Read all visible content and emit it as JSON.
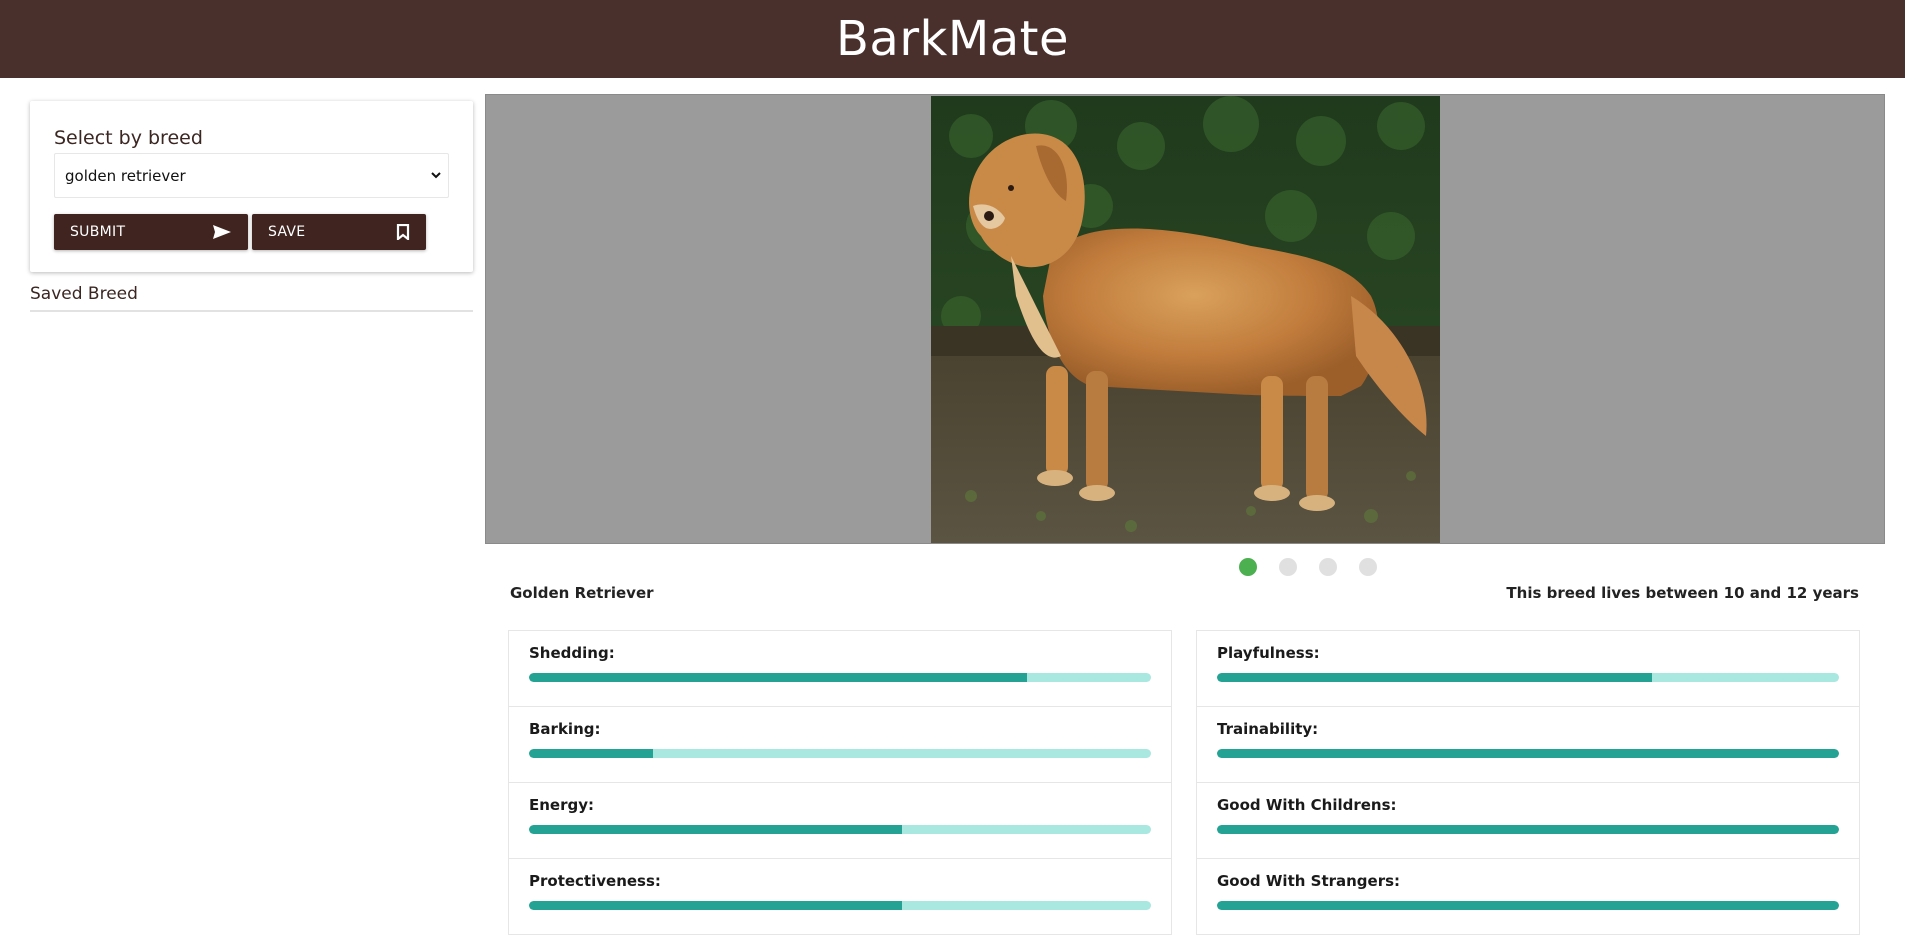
{
  "app": {
    "title": "BarkMate"
  },
  "sidebar": {
    "select_label": "Select by breed",
    "selected_breed": "golden retriever",
    "submit_label": "SUBMIT",
    "save_label": "SAVE",
    "saved_heading": "Saved Breed"
  },
  "carousel": {
    "image": "golden-retriever-photo",
    "slide_count": 4,
    "active_slide": 1
  },
  "breed": {
    "name": "Golden Retriever",
    "lifespan": "This breed lives between 10 and 12 years"
  },
  "traits_left": [
    {
      "label": "Shedding:",
      "value": 0.8
    },
    {
      "label": "Barking:",
      "value": 0.2
    },
    {
      "label": "Energy:",
      "value": 0.6
    },
    {
      "label": "Protectiveness:",
      "value": 0.6
    }
  ],
  "traits_right": [
    {
      "label": "Playfulness:",
      "value": 0.7
    },
    {
      "label": "Trainability:",
      "value": 1.0
    },
    {
      "label": "Good With Childrens:",
      "value": 1.0
    },
    {
      "label": "Good With Strangers:",
      "value": 1.0
    }
  ],
  "colors": {
    "header": "#4a302d",
    "button": "#3f2420",
    "bar_fill": "#24a394",
    "bar_track": "#a9e8e0",
    "dot_active": "#4caf50"
  },
  "icons": {
    "submit": "send-icon",
    "save": "bookmark-icon",
    "select": "chevron-down-icon"
  }
}
